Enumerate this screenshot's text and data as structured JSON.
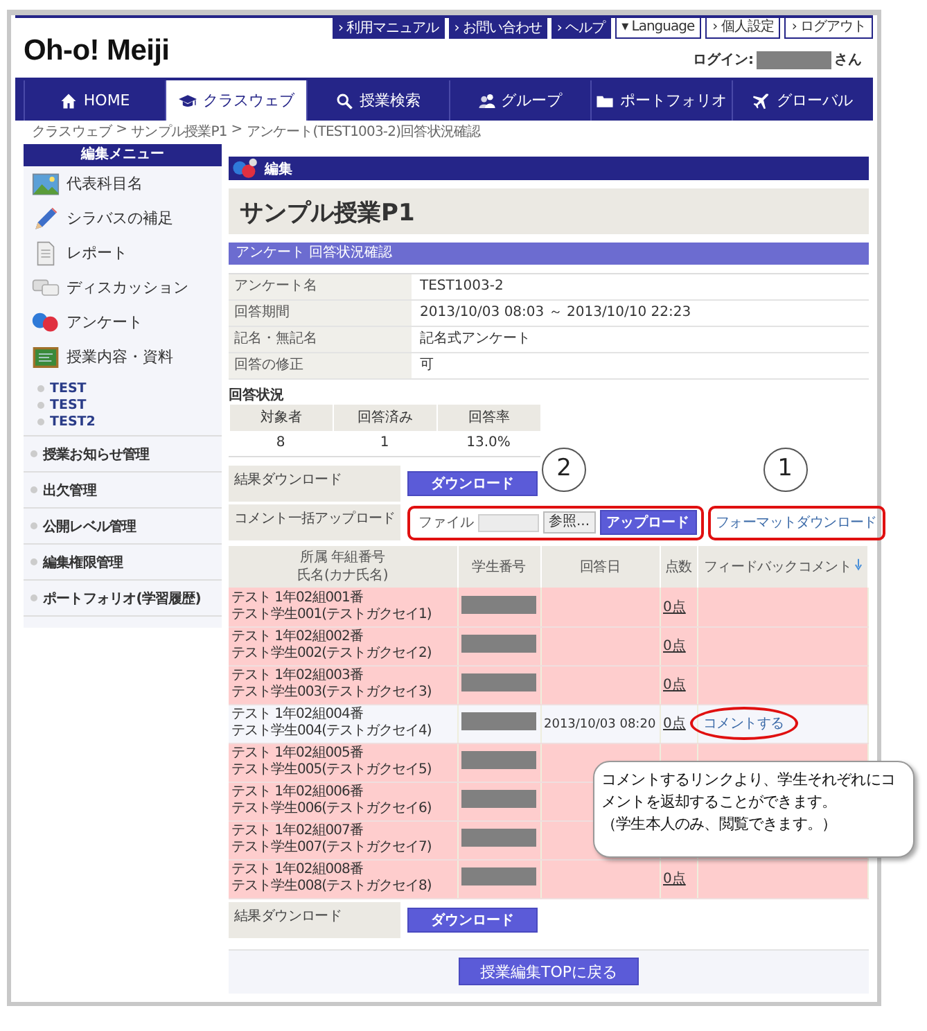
{
  "header": {
    "logo": "Oh-o! Meiji",
    "login_label": "ログイン:",
    "login_suffix": "さん",
    "top_links": [
      {
        "label": "› 利用マニュアル",
        "kind": "dark"
      },
      {
        "label": "› お問い合わせ",
        "kind": "dark"
      },
      {
        "label": "› ヘルプ",
        "kind": "dark"
      },
      {
        "label": "▾ Language",
        "kind": "light"
      },
      {
        "label": "› 個人設定",
        "kind": "light"
      },
      {
        "label": "› ログアウト",
        "kind": "light"
      }
    ]
  },
  "nav": [
    {
      "label": "HOME",
      "selected": false
    },
    {
      "label": "クラスウェブ",
      "selected": true
    },
    {
      "label": "授業検索",
      "selected": false
    },
    {
      "label": "グループ",
      "selected": false
    },
    {
      "label": "ポートフォリオ",
      "selected": false
    },
    {
      "label": "グローバル",
      "selected": false
    }
  ],
  "breadcrumb": {
    "separator": ">",
    "items": [
      "クラスウェブ",
      "サンプル授業P1",
      "アンケート(TEST1003-2)回答状況確認"
    ]
  },
  "sidebar": {
    "title": "編集メニュー",
    "items": [
      "代表科目名",
      "シラバスの補足",
      "レポート",
      "ディスカッション",
      "アンケート",
      "授業内容・資料"
    ],
    "sub_items": [
      "TEST",
      "TEST",
      "TEST2"
    ],
    "links": [
      "授業お知らせ管理",
      "出欠管理",
      "公開レベル管理",
      "編集権限管理",
      "ポートフォリオ(学習履歴)"
    ]
  },
  "main": {
    "section_title": "編集",
    "course_title": "サンプル授業P1",
    "subheader": "アンケート 回答状況確認",
    "info": [
      {
        "label": "アンケート名",
        "value": "TEST1003-2"
      },
      {
        "label": "回答期間",
        "value": "2013/10/03  08:03 ～  2013/10/10 22:23"
      },
      {
        "label": "記名・無記名",
        "value": "記名式アンケート"
      },
      {
        "label": "回答の修正",
        "value": "可"
      }
    ],
    "status_title": "回答状況",
    "status_columns": [
      "対象者",
      "回答済み",
      "回答率"
    ],
    "status_values": [
      "8",
      "1",
      "13.0%"
    ],
    "download_label": "結果ダウンロード",
    "download_button": "ダウンロード",
    "upload_label": "コメント一括アップロード",
    "file_label": "ファイル",
    "browse_button": "参照...",
    "upload_button": "アップロード",
    "format_link": "フォーマットダウンロード",
    "columns": [
      {
        "lines": [
          "所属 年組番号",
          "氏名(カナ氏名)"
        ]
      },
      {
        "lines": [
          "学生番号"
        ]
      },
      {
        "lines": [
          "回答日"
        ]
      },
      {
        "lines": [
          "点数"
        ]
      },
      {
        "lines": [
          "フィードバックコメント"
        ]
      }
    ],
    "rows": [
      {
        "group": "テスト 1年02組001番",
        "name": "テスト学生001(テストガクセイ1)",
        "answered": false,
        "score": "0点"
      },
      {
        "group": "テスト 1年02組002番",
        "name": "テスト学生002(テストガクセイ2)",
        "answered": false,
        "score": "0点"
      },
      {
        "group": "テスト 1年02組003番",
        "name": "テスト学生003(テストガクセイ3)",
        "answered": false,
        "score": "0点"
      },
      {
        "group": "テスト 1年02組004番",
        "name": "テスト学生004(テストガクセイ4)",
        "answered": true,
        "date": "2013/10/03 08:20",
        "score": "0点",
        "comment_link": "コメントする"
      },
      {
        "group": "テスト 1年02組005番",
        "name": "テスト学生005(テストガクセイ5)",
        "answered": false
      },
      {
        "group": "テスト 1年02組006番",
        "name": "テスト学生006(テストガクセイ6)",
        "answered": false
      },
      {
        "group": "テスト 1年02組007番",
        "name": "テスト学生007(テストガクセイ7)",
        "answered": false
      },
      {
        "group": "テスト 1年02組008番",
        "name": "テスト学生008(テストガクセイ8)",
        "answered": false,
        "score": "0点"
      }
    ],
    "bottom_download_label": "結果ダウンロード",
    "bottom_download_button": "ダウンロード",
    "back_button": "授業編集TOPに戻る"
  },
  "annotations": {
    "markers": [
      "2",
      "1"
    ],
    "callout": {
      "text": "コメントするリンクより、学生それぞれにコメントを返却することができます。",
      "note": "（学生本人のみ、閲覧できます。）"
    }
  }
}
